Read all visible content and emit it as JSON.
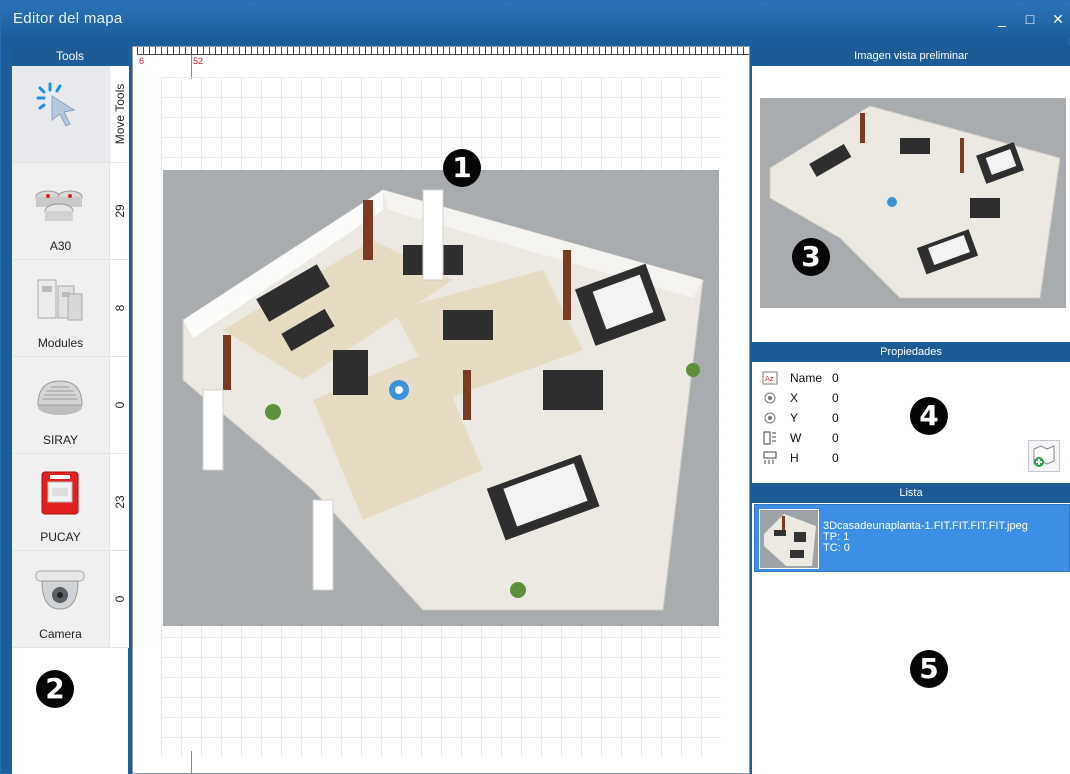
{
  "window": {
    "title": "Editor del mapa",
    "minimize": "_",
    "maximize": "□",
    "close": "✕"
  },
  "tools": {
    "header": "Tools",
    "items": [
      {
        "label": "",
        "count": "Move Tools",
        "icon": "cursor-click-icon"
      },
      {
        "label": "A30",
        "count": "29",
        "icon": "smoke-detector-icon"
      },
      {
        "label": "Modules",
        "count": "8",
        "icon": "module-icon"
      },
      {
        "label": "SIRAY",
        "count": "0",
        "icon": "siren-icon"
      },
      {
        "label": "PUCAY",
        "count": "23",
        "icon": "call-point-icon"
      },
      {
        "label": "Camera",
        "count": "0",
        "icon": "dome-camera-icon"
      }
    ]
  },
  "canvas": {
    "ruler_start": "6",
    "ruler_marker": "52"
  },
  "badges": {
    "b1": "1",
    "b2": "2",
    "b3": "3",
    "b4": "4",
    "b5": "5"
  },
  "preview": {
    "header": "Imagen vista preliminar"
  },
  "properties": {
    "header": "Propiedades",
    "rows": [
      {
        "name": "Name",
        "value": "0",
        "icon": "name-tag-icon"
      },
      {
        "name": "X",
        "value": "0",
        "icon": "target-icon"
      },
      {
        "name": "Y",
        "value": "0",
        "icon": "target-icon"
      },
      {
        "name": "W",
        "value": "0",
        "icon": "width-icon"
      },
      {
        "name": "H",
        "value": "0",
        "icon": "height-icon"
      }
    ]
  },
  "lista": {
    "header": "Lista",
    "items": [
      {
        "filename": "3Dcasadeunaplanta-1.FIT.FIT.FIT.FIT.jpeg",
        "tp": "TP: 1",
        "tc": "TC: 0"
      }
    ]
  },
  "colors": {
    "titlebar": "#1b5e9c",
    "header": "#1c5b96",
    "selected": "#3c8fe4"
  }
}
